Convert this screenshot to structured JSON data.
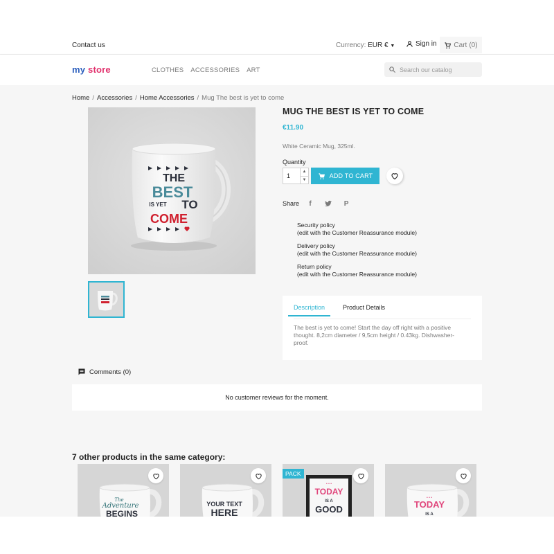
{
  "topbar": {
    "contact": "Contact us",
    "currency_label": "Currency:",
    "currency_value": "EUR €",
    "signin": "Sign in",
    "cart": "Cart",
    "cart_count": "(0)"
  },
  "header": {
    "logo_part1": "my",
    "logo_part2": "store",
    "nav": [
      "CLOTHES",
      "ACCESSORIES",
      "ART"
    ],
    "search_placeholder": "Search our catalog"
  },
  "breadcrumb": [
    "Home",
    "Accessories",
    "Home Accessories",
    "Mug The best is yet to come"
  ],
  "product": {
    "mug_text": {
      "line1": "THE",
      "line2": "BEST",
      "line3a": "IS YET",
      "line3b": "TO",
      "line4": "COME"
    },
    "title": "MUG THE BEST IS YET TO COME",
    "price": "€11.90",
    "short_desc": "White Ceramic Mug, 325ml.",
    "quantity_label": "Quantity",
    "quantity_value": "1",
    "add_to_cart": "ADD TO CART",
    "share_label": "Share",
    "share_icons": [
      "facebook-icon",
      "twitter-icon",
      "pinterest-icon"
    ]
  },
  "reassurance": [
    {
      "title": "Security policy",
      "note": "(edit with the Customer Reassurance module)"
    },
    {
      "title": "Delivery policy",
      "note": "(edit with the Customer Reassurance module)"
    },
    {
      "title": "Return policy",
      "note": "(edit with the Customer Reassurance module)"
    }
  ],
  "tabs": {
    "items": [
      "Description",
      "Product Details"
    ],
    "active": "Description",
    "content": "The best is yet to come! Start the day off right with a positive thought. 8,2cm diameter / 9,5cm height / 0.43kg. Dishwasher-proof."
  },
  "comments": {
    "label": "Comments (0)",
    "empty": "No customer reviews for the moment."
  },
  "related": {
    "heading": "7 other products in the same category:",
    "cards": [
      {
        "badge": "",
        "mug_line1": "The",
        "mug_line2": "Adventure",
        "mug_line3": "BEGINS"
      },
      {
        "badge": "",
        "mug_line1": "YOUR TEXT",
        "mug_line2": "HERE",
        "mug_line3": ""
      },
      {
        "badge": "PACK",
        "mug_line1": "TODAY",
        "mug_line2": "IS A",
        "mug_line3": "GOOD"
      },
      {
        "badge": "",
        "mug_line1": "TODAY",
        "mug_line2": "IS A",
        "mug_line3": ""
      }
    ]
  },
  "colors": {
    "accent": "#2fb5d2",
    "mug_red": "#d0202e",
    "mug_teal": "#4a8b9a",
    "mug_dark": "#2b2f3a",
    "pink": "#e1306c"
  }
}
